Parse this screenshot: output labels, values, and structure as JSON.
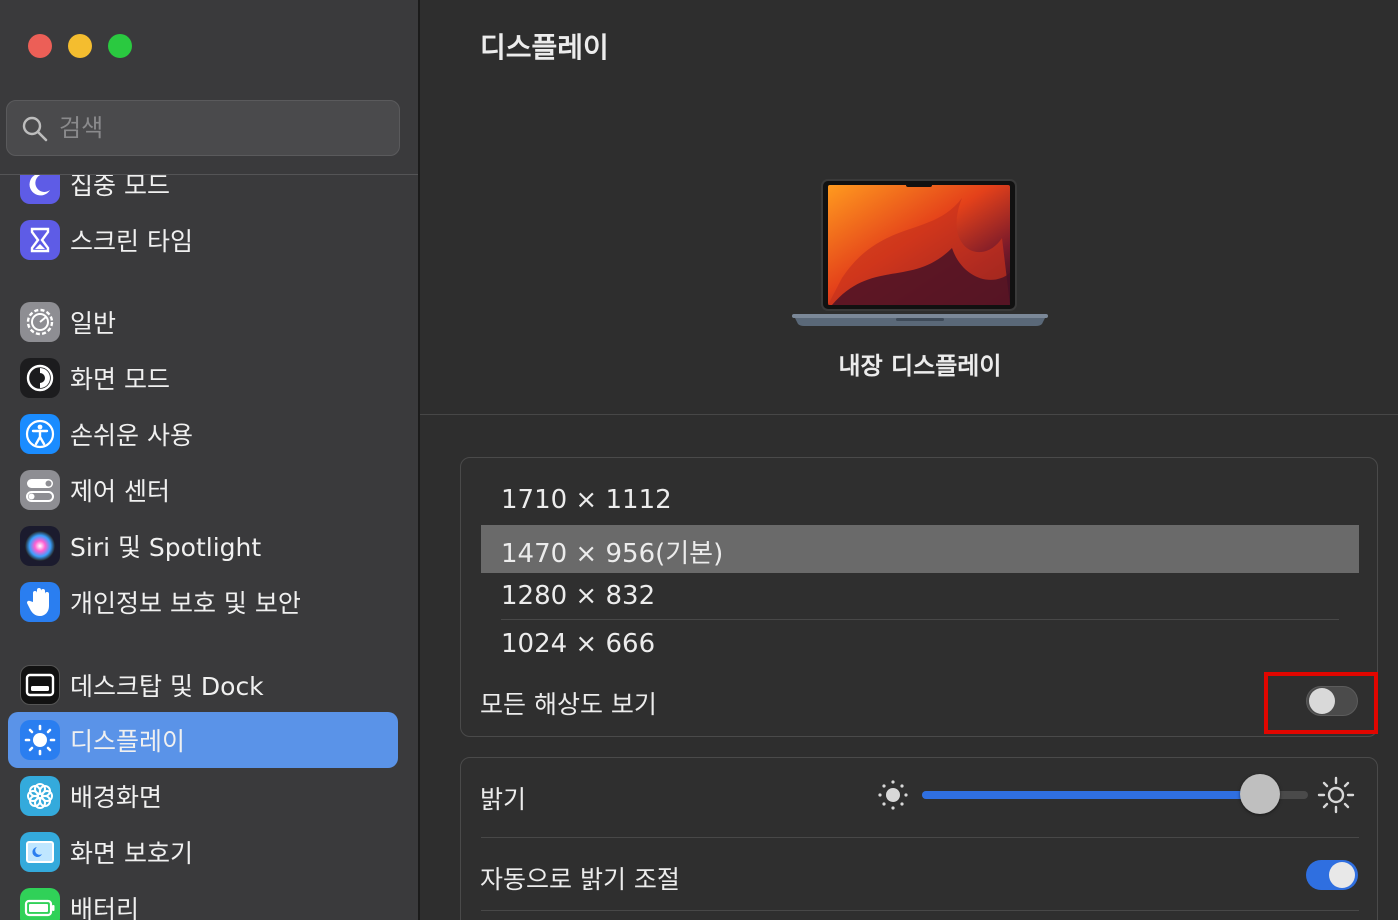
{
  "window": {
    "title": "디스플레이"
  },
  "search": {
    "placeholder": "검색"
  },
  "sidebar": {
    "items": [
      {
        "label": "집중 모드",
        "icon": "moon-icon",
        "color": "#5e5ce6"
      },
      {
        "label": "스크린 타임",
        "icon": "hourglass-icon",
        "color": "#5e5ce6"
      },
      {
        "label": "일반",
        "icon": "gear-icon",
        "color": "#8e8e93"
      },
      {
        "label": "화면 모드",
        "icon": "appearance-icon",
        "color": "#1c1c1e"
      },
      {
        "label": "손쉬운 사용",
        "icon": "accessibility-icon",
        "color": "#1a8cff"
      },
      {
        "label": "제어 센터",
        "icon": "control-center-icon",
        "color": "#8e8e93"
      },
      {
        "label": "Siri 및 Spotlight",
        "icon": "siri-icon",
        "color": "#2d2d4a"
      },
      {
        "label": "개인정보 보호 및 보안",
        "icon": "hand-icon",
        "color": "#2a7ef0"
      },
      {
        "label": "데스크탑 및 Dock",
        "icon": "dock-icon",
        "color": "#1c1c1e"
      },
      {
        "label": "디스플레이",
        "icon": "sun-icon",
        "color": "#2a7ef0",
        "selected": true
      },
      {
        "label": "배경화면",
        "icon": "flower-icon",
        "color": "#34aadc"
      },
      {
        "label": "화면 보호기",
        "icon": "screensaver-icon",
        "color": "#34aadc"
      },
      {
        "label": "배터리",
        "icon": "battery-icon",
        "color": "#30d158"
      }
    ]
  },
  "display": {
    "device_label": "내장 디스플레이",
    "resolutions": [
      {
        "label": "1710 × 1112",
        "selected": false
      },
      {
        "label": "1470 × 956(기본)",
        "selected": true
      },
      {
        "label": "1280 × 832",
        "selected": false
      },
      {
        "label": "1024 × 666",
        "selected": false
      }
    ],
    "show_all_label": "모든 해상도 보기",
    "show_all_enabled": false,
    "brightness_label": "밝기",
    "brightness_value": 0.92,
    "auto_brightness_label": "자동으로 밝기 조절",
    "auto_brightness_enabled": true
  },
  "colors": {
    "accent": "#2f6fe0",
    "selected_sidebar": "#5a93e8",
    "highlight": "#e10600"
  }
}
